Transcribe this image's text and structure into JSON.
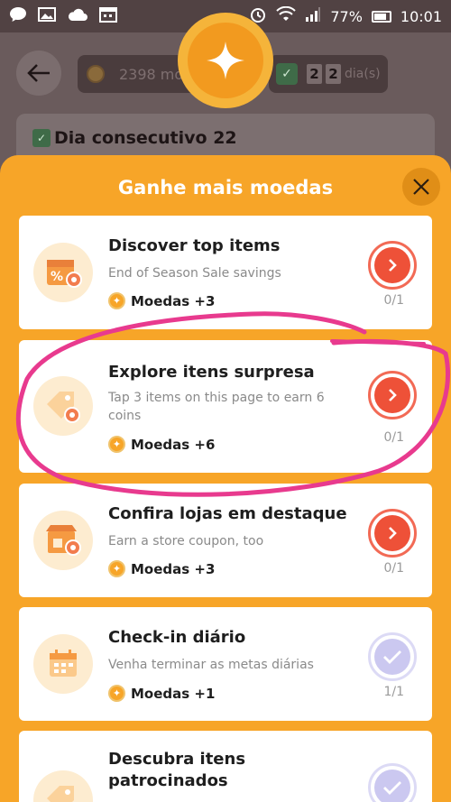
{
  "status_bar": {
    "battery": "77%",
    "time": "10:01"
  },
  "background": {
    "coins_value": "2398 mo",
    "days_digits": [
      "2",
      "2"
    ],
    "days_label": "dia(s)",
    "streak_title": "Dia consecutivo 22"
  },
  "sheet": {
    "title": "Ganhe mais moedas",
    "tasks": [
      {
        "title": "Discover top items",
        "description": "End of Season Sale savings",
        "reward": "Moedas +3",
        "progress": "0/1",
        "status": "pending",
        "icon": "sale-tag-icon"
      },
      {
        "title": "Explore itens surpresa",
        "description": "Tap 3 items on this page to earn 6 coins",
        "reward": "Moedas +6",
        "progress": "0/1",
        "status": "pending",
        "icon": "tag-icon"
      },
      {
        "title": "Confira lojas em destaque",
        "description": "Earn a store coupon, too",
        "reward": "Moedas +3",
        "progress": "0/1",
        "status": "pending",
        "icon": "store-icon"
      },
      {
        "title": "Check-in diário",
        "description": "Venha terminar as metas diárias",
        "reward": "Moedas +1",
        "progress": "1/1",
        "status": "done",
        "icon": "calendar-icon"
      },
      {
        "title": "Descubra itens patrocinados",
        "description": "",
        "reward": "",
        "progress": "",
        "status": "done",
        "icon": "tag-icon"
      }
    ]
  },
  "colors": {
    "sheet_orange": "#f7a528",
    "go_red": "#ee5138",
    "done_lavender": "#cbc8f0",
    "annotation_pink": "#e83a8e"
  }
}
